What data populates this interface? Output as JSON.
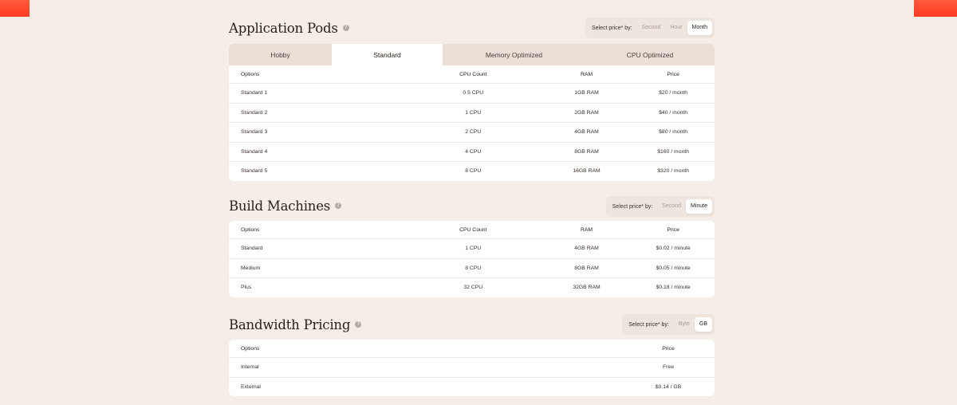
{
  "application_pods": {
    "title": "Application Pods",
    "selector": {
      "label": "Select price* by:",
      "options": [
        "Second",
        "Hour",
        "Month"
      ],
      "active": "Month"
    },
    "tabs": [
      "Hobby",
      "Standard",
      "Memory Optimized",
      "CPU Optimized"
    ],
    "active_tab": "Standard",
    "columns": [
      "Options",
      "CPU Count",
      "RAM",
      "Price"
    ],
    "rows": [
      [
        "Standard 1",
        "0.5 CPU",
        "1GB RAM",
        "$20 / month"
      ],
      [
        "Standard 2",
        "1 CPU",
        "2GB RAM",
        "$40 / month"
      ],
      [
        "Standard 3",
        "2 CPU",
        "4GB RAM",
        "$80 / month"
      ],
      [
        "Standard 4",
        "4 CPU",
        "8GB RAM",
        "$160 / month"
      ],
      [
        "Standard 5",
        "8 CPU",
        "16GB RAM",
        "$320 / month"
      ]
    ]
  },
  "build_machines": {
    "title": "Build Machines",
    "selector": {
      "label": "Select price* by:",
      "options": [
        "Second",
        "Minute"
      ],
      "active": "Minute"
    },
    "columns": [
      "Options",
      "CPU Count",
      "RAM",
      "Price"
    ],
    "rows": [
      [
        "Standard",
        "1 CPU",
        "4GB RAM",
        "$0.02 / minute"
      ],
      [
        "Medium",
        "8 CPU",
        "8GB RAM",
        "$0.05 / minute"
      ],
      [
        "Plus",
        "32 CPU",
        "32GB RAM",
        "$0.18 / minute"
      ]
    ]
  },
  "bandwidth_pricing": {
    "title": "Bandwidth Pricing",
    "selector": {
      "label": "Select price* by:",
      "options": [
        "Byte",
        "GB"
      ],
      "active": "GB"
    },
    "columns": [
      "Options",
      "Price"
    ],
    "rows": [
      [
        "Internal",
        "Free"
      ],
      [
        "External",
        "$0.14 / GB"
      ]
    ]
  },
  "icons": {
    "help": "help-circle-icon"
  },
  "colors": {
    "background": "#f5ede8",
    "accent": "#ff4a2e",
    "tab_bar": "#ebdfd8",
    "card": "#ffffff"
  }
}
